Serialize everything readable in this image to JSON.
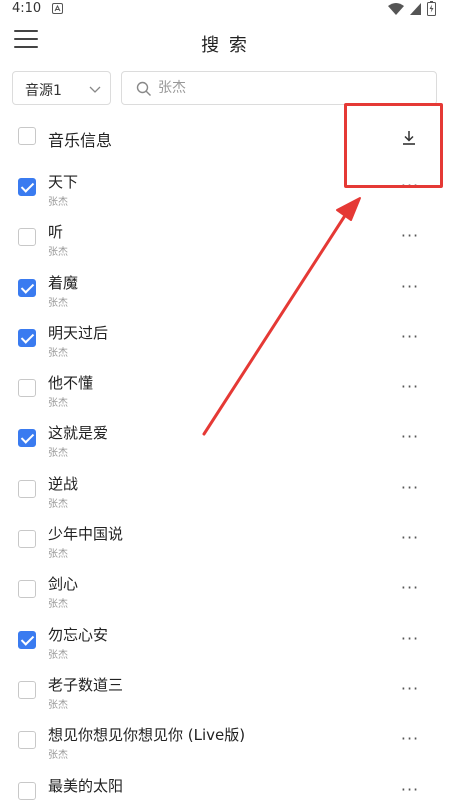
{
  "status_bar": {
    "time": "4:10"
  },
  "app_bar": {
    "title": "搜 索"
  },
  "source_select": {
    "value": "音源1"
  },
  "search": {
    "value": "",
    "placeholder": "张杰"
  },
  "header": {
    "label": "音乐信息",
    "select_all_checked": false
  },
  "songs": [
    {
      "title": "天下",
      "artist": "张杰",
      "checked": true
    },
    {
      "title": "听",
      "artist": "张杰",
      "checked": false
    },
    {
      "title": "着魔",
      "artist": "张杰",
      "checked": true
    },
    {
      "title": "明天过后",
      "artist": "张杰",
      "checked": true
    },
    {
      "title": "他不懂",
      "artist": "张杰",
      "checked": false
    },
    {
      "title": "这就是爱",
      "artist": "张杰",
      "checked": true
    },
    {
      "title": "逆战",
      "artist": "张杰",
      "checked": false
    },
    {
      "title": "少年中国说",
      "artist": "张杰",
      "checked": false
    },
    {
      "title": "剑心",
      "artist": "张杰",
      "checked": false
    },
    {
      "title": "勿忘心安",
      "artist": "张杰",
      "checked": true
    },
    {
      "title": "老子数道三",
      "artist": "张杰",
      "checked": false
    },
    {
      "title": "想见你想见你想见你 (Live版)",
      "artist": "张杰",
      "checked": false
    },
    {
      "title": "最美的太阳",
      "artist": "张杰",
      "checked": false
    }
  ],
  "more_label": "···",
  "colors": {
    "accent": "#3a7bf0",
    "annotation": "#e53935"
  },
  "icons": {
    "menu": "hamburger-menu-icon",
    "search": "search-icon",
    "chevron": "chevron-down-icon",
    "download": "download-icon",
    "more": "more-horizontal-icon"
  }
}
